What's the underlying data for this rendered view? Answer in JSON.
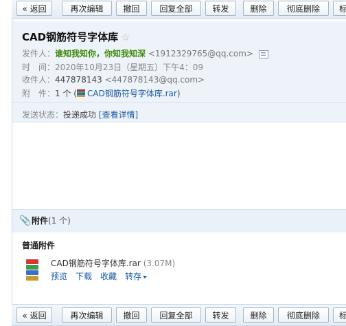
{
  "toolbar": {
    "back": "« 返回",
    "resend": "再次编辑",
    "recall": "撤回",
    "reply_all": "回复全部",
    "forward": "转发",
    "delete": "删除",
    "delete_perm": "彻底删除",
    "mark": "标"
  },
  "mail": {
    "subject": "CAD钢筋符号字体库",
    "star": "☆",
    "from_label": "发件人：",
    "from_name": "谁知我知你，你知我知深",
    "from_addr": "<1912329765@qq.com>",
    "time_label": "时　间：",
    "time_value": "2020年10月23日（星期五）下午4：09",
    "to_label": "收件人：",
    "to_name": "447878143",
    "to_addr": "<447878143@qq.com>",
    "attach_label": "附　件：",
    "attach_count": "1 个",
    "attach_link": "CAD钢筋符号字体库.rar",
    "status_label": "发送状态：",
    "status_value": "投递成功",
    "status_link": "[查看详情]"
  },
  "attachments": {
    "title": "附件",
    "count": "(1 个)",
    "section": "普通附件",
    "file": {
      "name": "CAD钢筋符号字体库.rar",
      "size": "(3.07M)",
      "actions": [
        "预览",
        "下载",
        "收藏",
        "转存"
      ]
    }
  },
  "colors": {
    "sender": "#3c8a0d",
    "link": "#1a5aa5",
    "header_bg": "#eef3f9"
  }
}
